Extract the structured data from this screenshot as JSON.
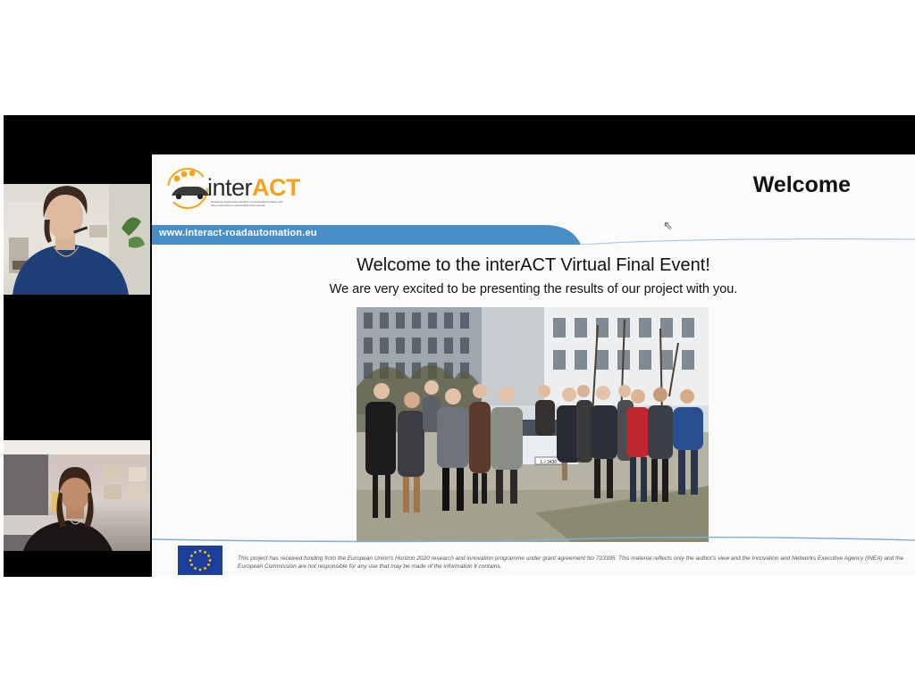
{
  "slide": {
    "logo_prefix": "inter",
    "logo_suffix": "ACT",
    "logo_tagline": "Designing cooperative interaction of automated vehicles with other road users in mixed traffic environments",
    "title": "Welcome",
    "url": "www.interact-roadautomation.eu",
    "heading": "Welcome to the interACT Virtual Final Event!",
    "subheading": "We are very excited to be presenting the results of our project with you.",
    "license_plate": "L·I 3430",
    "disclaimer": "This project has received funding from the European Union's Horizon 2020 research and innovation programme under grant agreement No 723395. This material reflects only the author's view and the Innovation and Networks Executive Agency (INEA) and the European Commission are not responsible for any use that may be made of the information it contains."
  },
  "colors": {
    "url_band": "#4a8ec8",
    "logo_accent": "#f2a51c",
    "eu_blue": "#1b3f9b",
    "eu_stars": "#ffcc00"
  },
  "icons": {
    "pointer": "mouse-pointer-icon"
  }
}
